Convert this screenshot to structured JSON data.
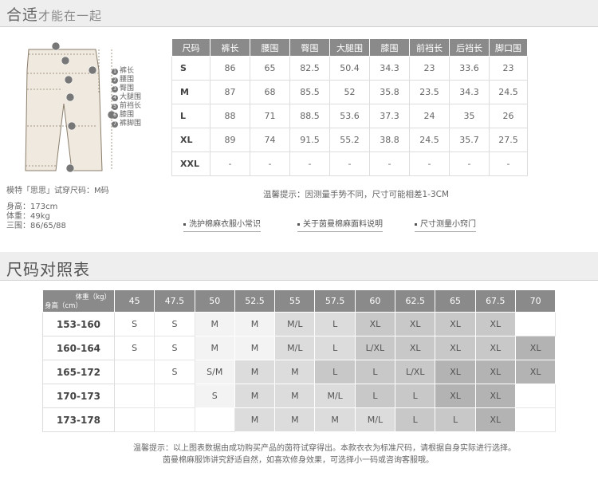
{
  "header1": {
    "title_big": "合适",
    "title_small": "才能在一起"
  },
  "figure": {
    "legend": [
      "裤长",
      "腰围",
      "臀围",
      "大腿围",
      "前裆长",
      "膝围",
      "裤脚围"
    ],
    "legend_nums": [
      "1",
      "2",
      "3",
      "4",
      "5",
      "6",
      "7"
    ]
  },
  "model": {
    "line": "模特「思思」试穿尺码：M码",
    "height": "身高：173cm",
    "weight": "体重：49kg",
    "measure": "三围：86/65/88"
  },
  "size_table": {
    "headers": [
      "尺码",
      "裤长",
      "腰围",
      "臀围",
      "大腿围",
      "膝围",
      "前裆长",
      "后裆长",
      "脚口围"
    ],
    "rows": [
      [
        "S",
        "86",
        "65",
        "82.5",
        "50.4",
        "34.3",
        "23",
        "33.6",
        "23"
      ],
      [
        "M",
        "87",
        "68",
        "85.5",
        "52",
        "35.8",
        "23.5",
        "34.3",
        "24.5"
      ],
      [
        "L",
        "88",
        "71",
        "88.5",
        "53.6",
        "37.3",
        "24",
        "35",
        "26"
      ],
      [
        "XL",
        "89",
        "74",
        "91.5",
        "55.2",
        "38.8",
        "24.5",
        "35.7",
        "27.5"
      ],
      [
        "XXL",
        "-",
        "-",
        "-",
        "-",
        "-",
        "-",
        "-",
        "-"
      ]
    ]
  },
  "tip": "温馨提示：因测量手势不同，尺寸可能相差1-3CM",
  "links": [
    "洗护棉麻衣服小常识",
    "关于茵曼棉麻面料说明",
    "尺寸测量小窍门"
  ],
  "header2": {
    "title": "尺码对照表"
  },
  "chart": {
    "corner_weight": "体重（kg）",
    "corner_height": "身高（cm）",
    "weights": [
      "45",
      "47.5",
      "50",
      "52.5",
      "55",
      "57.5",
      "60",
      "62.5",
      "65",
      "67.5",
      "70"
    ],
    "rows": [
      {
        "height": "153-160",
        "cells": [
          "S",
          "S",
          "M",
          "M",
          "M/L",
          "L",
          "XL",
          "XL",
          "XL",
          "XL",
          ""
        ],
        "shades": [
          0,
          0,
          1,
          1,
          2,
          2,
          3,
          3,
          3,
          3,
          0
        ]
      },
      {
        "height": "160-164",
        "cells": [
          "S",
          "S",
          "M",
          "M",
          "M/L",
          "L",
          "L/XL",
          "XL",
          "XL",
          "XL",
          "XL"
        ],
        "shades": [
          0,
          0,
          1,
          1,
          2,
          2,
          3,
          3,
          3,
          3,
          4
        ]
      },
      {
        "height": "165-172",
        "cells": [
          "",
          "S",
          "S/M",
          "M",
          "M",
          "L",
          "L",
          "L/XL",
          "XL",
          "XL",
          "XL"
        ],
        "shades": [
          0,
          0,
          1,
          2,
          2,
          3,
          3,
          3,
          4,
          4,
          4
        ]
      },
      {
        "height": "170-173",
        "cells": [
          "",
          "",
          "S",
          "M",
          "M",
          "M/L",
          "L",
          "L",
          "XL",
          "XL",
          ""
        ],
        "shades": [
          0,
          0,
          1,
          2,
          2,
          2,
          3,
          3,
          4,
          4,
          0
        ]
      },
      {
        "height": "173-178",
        "cells": [
          "",
          "",
          "",
          "M",
          "M",
          "M",
          "M/L",
          "L",
          "L",
          "XL",
          ""
        ],
        "shades": [
          0,
          0,
          0,
          2,
          2,
          2,
          2,
          3,
          3,
          4,
          0
        ]
      }
    ]
  },
  "warm": {
    "line1": "温馨提示：以上图表数据由成功购买产品的茵符试穿得出。本款衣衣为标准尺码，请根据自身实际进行选择。",
    "line2": "茵曼棉麻服饰讲究舒适自然，如喜欢修身效果，可选择小一码或咨询客服哦。"
  },
  "colors": {
    "header_bg": "#eeeeee",
    "table_header": "#8a8a8a",
    "shade_light": "#f3f3f3",
    "shade_dark": "#b3b3b3"
  }
}
